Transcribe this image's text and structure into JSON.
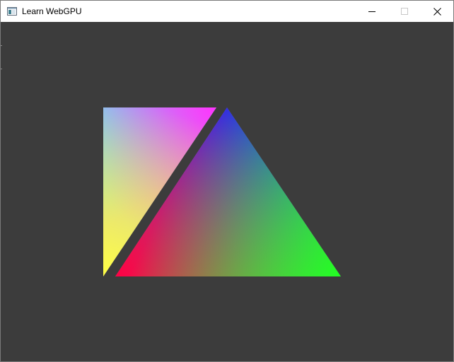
{
  "window": {
    "title": "Learn WebGPU",
    "app_icon": "window-app-icon",
    "controls": {
      "minimize_icon": "minimize-icon",
      "maximize_icon": "maximize-icon",
      "close_icon": "close-icon"
    }
  },
  "scene": {
    "clear_color": "#3c3c3c",
    "triangles": [
      {
        "name": "left-triangle",
        "vertex_colors": [
          "#44ffff",
          "#ff33ff",
          "#ffff44"
        ]
      },
      {
        "name": "right-triangle",
        "vertex_colors": [
          "#2222ff",
          "#ff0044",
          "#22ff22"
        ]
      }
    ]
  }
}
